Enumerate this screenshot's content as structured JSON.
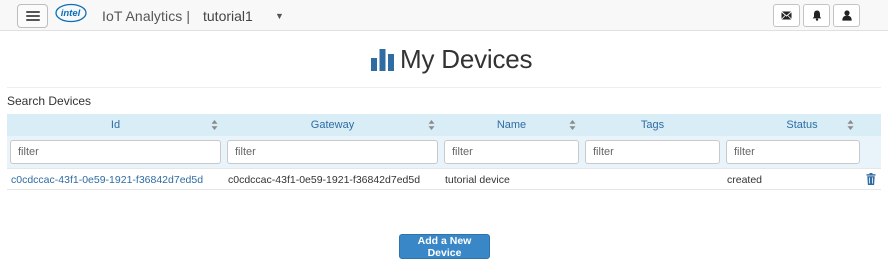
{
  "navbar": {
    "brand_logo": "intel",
    "app_title": "IoT Analytics |",
    "account_name": "tutorial1",
    "icons": [
      "hamburger-menu-icon",
      "envelope-icon",
      "bell-icon",
      "user-icon"
    ]
  },
  "page": {
    "title": "My Devices",
    "title_icon": "bar-chart-icon"
  },
  "search": {
    "label": "Search Devices"
  },
  "table": {
    "columns": [
      "Id",
      "Gateway",
      "Name",
      "Tags",
      "Status"
    ],
    "filter_placeholder": "filter",
    "rows": [
      {
        "id": "c0cdccac-43f1-0e59-1921-f36842d7ed5d",
        "gateway": "c0cdccac-43f1-0e59-1921-f36842d7ed5d",
        "name": "tutorial device",
        "tags": "",
        "status": "created"
      }
    ]
  },
  "actions": {
    "add_device": "Add a New Device"
  },
  "colors": {
    "header_bg": "#d9edf7",
    "link": "#2f6ca2",
    "primary_button": "#3a87c8",
    "title_icon": "#2f6ca2"
  }
}
